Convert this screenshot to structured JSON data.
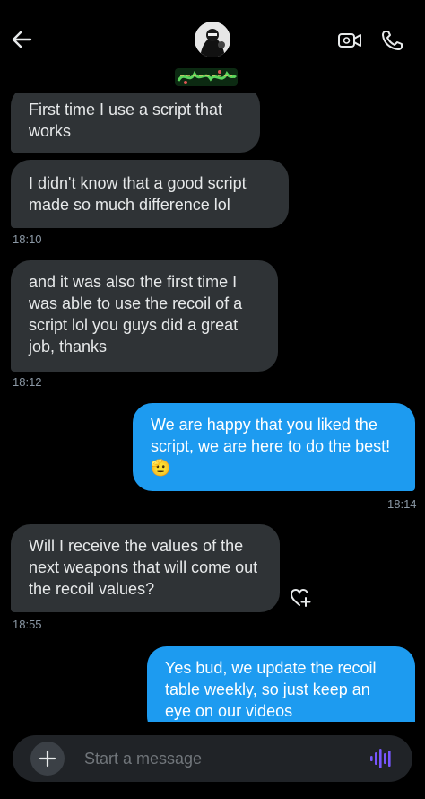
{
  "header": {
    "icons": {
      "back": "back-arrow-icon",
      "video": "video-call-icon",
      "phone": "phone-call-icon"
    },
    "contact_name_art": "stylized contact name graphic"
  },
  "messages": [
    {
      "dir": "in",
      "text": "First time I use a script that works"
    },
    {
      "dir": "in",
      "text": "I didn't know that a good script made so much difference lol",
      "time": "18:10"
    },
    {
      "dir": "in",
      "text": "and it was also the first time I was able to use the recoil of a script lol you guys did a great job, thanks",
      "time": "18:12"
    },
    {
      "dir": "out",
      "text": "We are happy that you liked the script, we are here to do the best!",
      "emoji": "🫡",
      "time": "18:14"
    },
    {
      "dir": "in",
      "text": "Will I receive the values of the next weapons that will come out the recoil values?",
      "time": "18:55"
    },
    {
      "dir": "out",
      "text": "Yes bud, we update the recoil table weekly, so just keep an eye on our videos"
    }
  ],
  "composer": {
    "placeholder": "Start a message",
    "plus_label": "+",
    "icons": {
      "add": "plus-icon",
      "voice": "voice-message-icon"
    }
  },
  "colors": {
    "background": "#000000",
    "incoming_bubble": "#2f3336",
    "outgoing_bubble": "#1d9bf0",
    "timestamp": "#8b98a5",
    "accent_voice": "#7856ff"
  }
}
